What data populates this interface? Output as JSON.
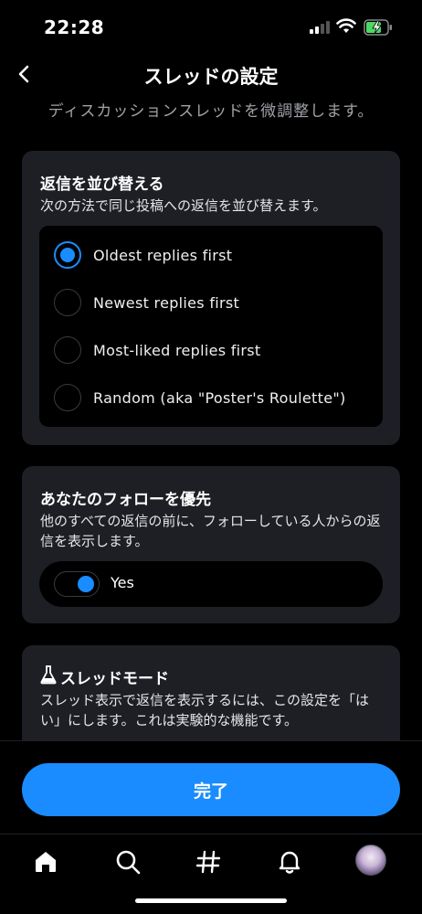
{
  "status": {
    "time": "22:28"
  },
  "header": {
    "title": "スレッドの設定",
    "subtitle": "ディスカッションスレッドを微調整します。"
  },
  "sort_card": {
    "title": "返信を並び替える",
    "description": "次の方法で同じ投稿への返信を並び替えます。",
    "options": [
      {
        "label": "Oldest replies first",
        "selected": true
      },
      {
        "label": "Newest replies first",
        "selected": false
      },
      {
        "label": "Most-liked replies first",
        "selected": false
      },
      {
        "label": "Random (aka \"Poster's Roulette\")",
        "selected": false
      }
    ]
  },
  "follow_card": {
    "title": "あなたのフォローを優先",
    "description": "他のすべての返信の前に、フォローしている人からの返信を表示します。",
    "toggle_label": "Yes",
    "toggle_on": true
  },
  "thread_mode_card": {
    "title": "スレッドモード",
    "icon": "flask-icon",
    "description": "スレッド表示で返信を表示するには、この設定を「はい」にします。これは実験的な機能です。"
  },
  "done_button": {
    "label": "完了"
  },
  "tabs": [
    "home-icon",
    "search-icon",
    "hashtag-icon",
    "bell-icon",
    "avatar"
  ],
  "colors": {
    "accent": "#1a8cff",
    "card": "#1e1f25",
    "background": "#000000"
  }
}
